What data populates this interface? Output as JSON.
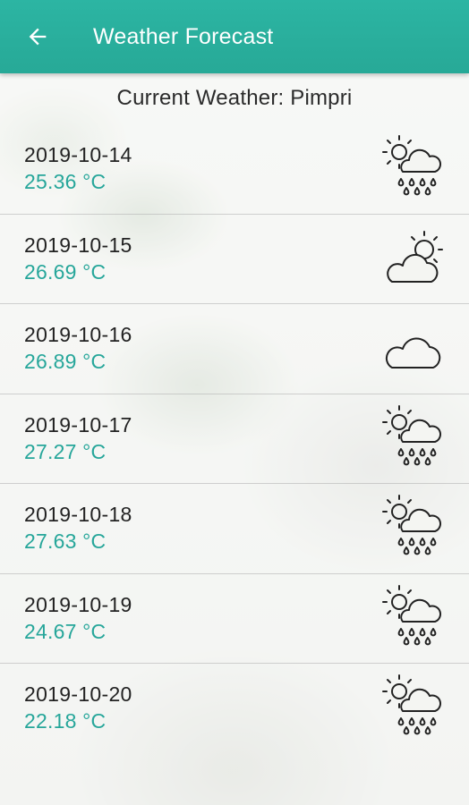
{
  "app_bar": {
    "title": "Weather Forecast",
    "back_icon": "arrow-left-icon",
    "color": "#27a997"
  },
  "header": {
    "current_weather_label": "Current Weather: Pimpri"
  },
  "forecast": [
    {
      "date": "2019-10-14",
      "temp": "25.36 °C",
      "icon": "sun-cloud-rain-icon"
    },
    {
      "date": "2019-10-15",
      "temp": "26.69 °C",
      "icon": "cloud-sun-icon"
    },
    {
      "date": "2019-10-16",
      "temp": "26.89 °C",
      "icon": "cloud-icon"
    },
    {
      "date": "2019-10-17",
      "temp": "27.27 °C",
      "icon": "sun-cloud-rain-icon"
    },
    {
      "date": "2019-10-18",
      "temp": "27.63 °C",
      "icon": "sun-cloud-rain-icon"
    },
    {
      "date": "2019-10-19",
      "temp": "24.67 °C",
      "icon": "sun-cloud-rain-icon"
    },
    {
      "date": "2019-10-20",
      "temp": "22.18 °C",
      "icon": "sun-cloud-rain-icon"
    }
  ],
  "colors": {
    "temperature_text": "#26a69a",
    "date_text": "#222222"
  }
}
